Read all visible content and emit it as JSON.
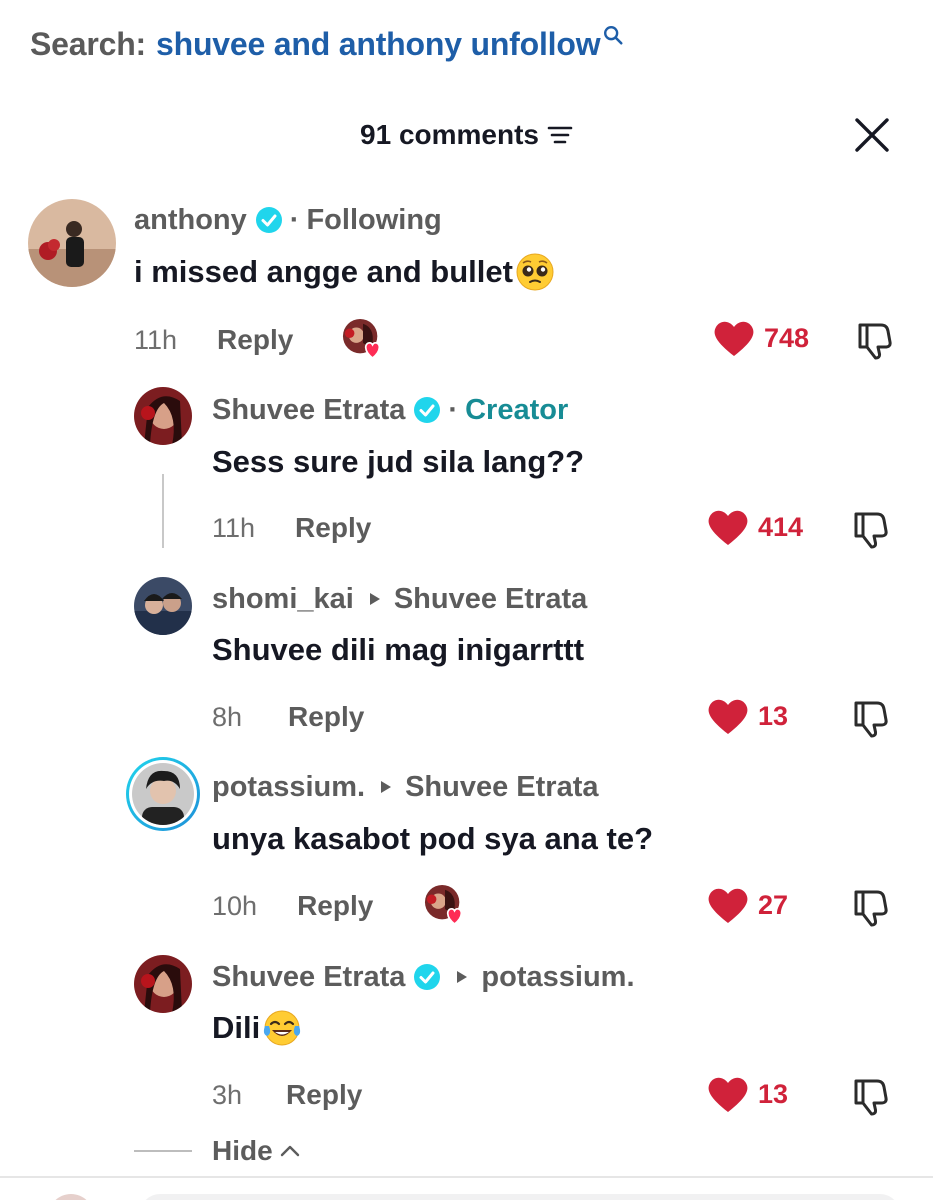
{
  "search": {
    "prefix": "Search:",
    "query": "shuvee and anthony unfollow"
  },
  "header": {
    "title": "91 comments"
  },
  "comments": [
    {
      "username": "anthony",
      "verified": true,
      "tag_separator": "·",
      "tag": "Following",
      "text": "i missed angge and bullet",
      "emoji": "pleading-face-emoji",
      "time": "11h",
      "reply_label": "Reply",
      "liked_by_creator": true,
      "likes": "748"
    },
    {
      "username": "Shuvee Etrata",
      "verified": true,
      "tag_separator": "·",
      "tag": "Creator",
      "text": "Sess sure jud sila lang??",
      "time": "11h",
      "reply_label": "Reply",
      "liked_by_creator": false,
      "likes": "414"
    },
    {
      "username": "shomi_kai",
      "verified": false,
      "reply_to": "Shuvee Etrata",
      "text": "Shuvee dili mag inigarrttt",
      "time": "8h",
      "reply_label": "Reply",
      "liked_by_creator": false,
      "likes": "13"
    },
    {
      "username": "potassium.",
      "verified": false,
      "reply_to": "Shuvee Etrata",
      "text": "unya kasabot pod sya ana te?",
      "time": "10h",
      "reply_label": "Reply",
      "liked_by_creator": true,
      "likes": "27"
    },
    {
      "username": "Shuvee Etrata",
      "verified": true,
      "reply_to": "potassium.",
      "text": "Dili",
      "emoji": "tears-of-joy-emoji",
      "time": "3h",
      "reply_label": "Reply",
      "liked_by_creator": false,
      "likes": "13"
    }
  ],
  "hide_label": "Hide",
  "colors": {
    "like_red": "#d0223a",
    "search_blue": "#1e5ea8",
    "creator_teal": "#178c95",
    "verified_blue": "#20d5ec",
    "muted_gray": "#5c5c5c"
  }
}
